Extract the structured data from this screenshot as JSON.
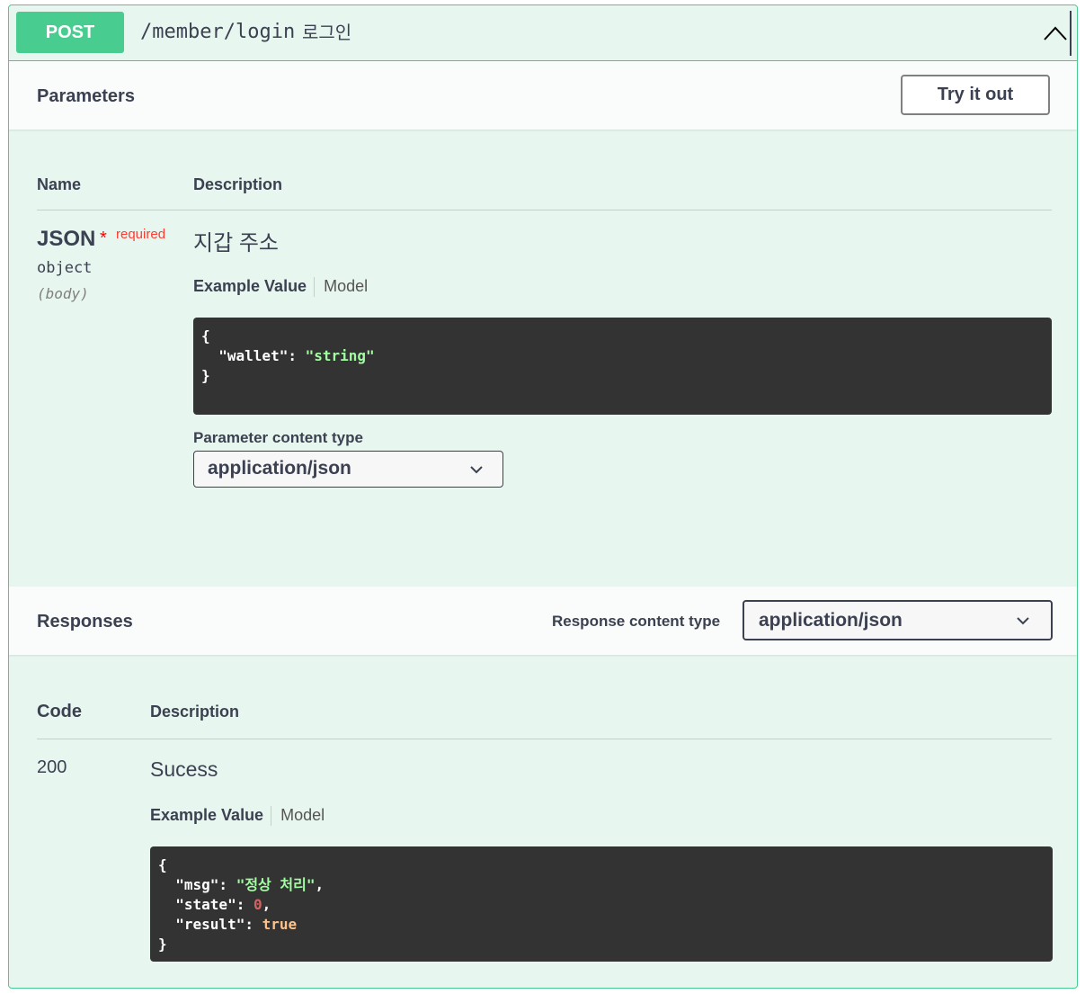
{
  "operation": {
    "method": "POST",
    "path": "/member/login",
    "summary": "로그인"
  },
  "parameters": {
    "title": "Parameters",
    "try_label": "Try it out",
    "col_name": "Name",
    "col_description": "Description",
    "param": {
      "name": "JSON",
      "required_star": "*",
      "required_label": "required",
      "type": "object",
      "in": "(body)",
      "description": "지갑 주소"
    },
    "tabs": {
      "example": "Example Value",
      "model": "Model"
    },
    "example_lines": {
      "open": "{",
      "wallet_key": "  \"wallet\": ",
      "wallet_val": "\"string\"",
      "close": "}"
    },
    "content_type_label": "Parameter content type",
    "content_type_value": "application/json"
  },
  "responses": {
    "title": "Responses",
    "content_type_label": "Response content type",
    "content_type_value": "application/json",
    "col_code": "Code",
    "col_description": "Description",
    "rows": [
      {
        "code": "200",
        "description": "Sucess",
        "tabs": {
          "example": "Example Value",
          "model": "Model"
        },
        "example": {
          "open": "{",
          "msg_key": "  \"msg\": ",
          "msg_val": "\"정상 처리\"",
          "msg_comma": ",",
          "state_key": "  \"state\": ",
          "state_val": "0",
          "state_comma": ",",
          "result_key": "  \"result\": ",
          "result_val": "true",
          "close": "}"
        }
      }
    ]
  },
  "colors": {
    "post": "#49cc90",
    "background": "#e8f6f0",
    "code_bg": "#333333",
    "string": "#a2fca2",
    "number": "#d36363",
    "boolean": "#fcc28c",
    "required": "#ff3b30"
  }
}
